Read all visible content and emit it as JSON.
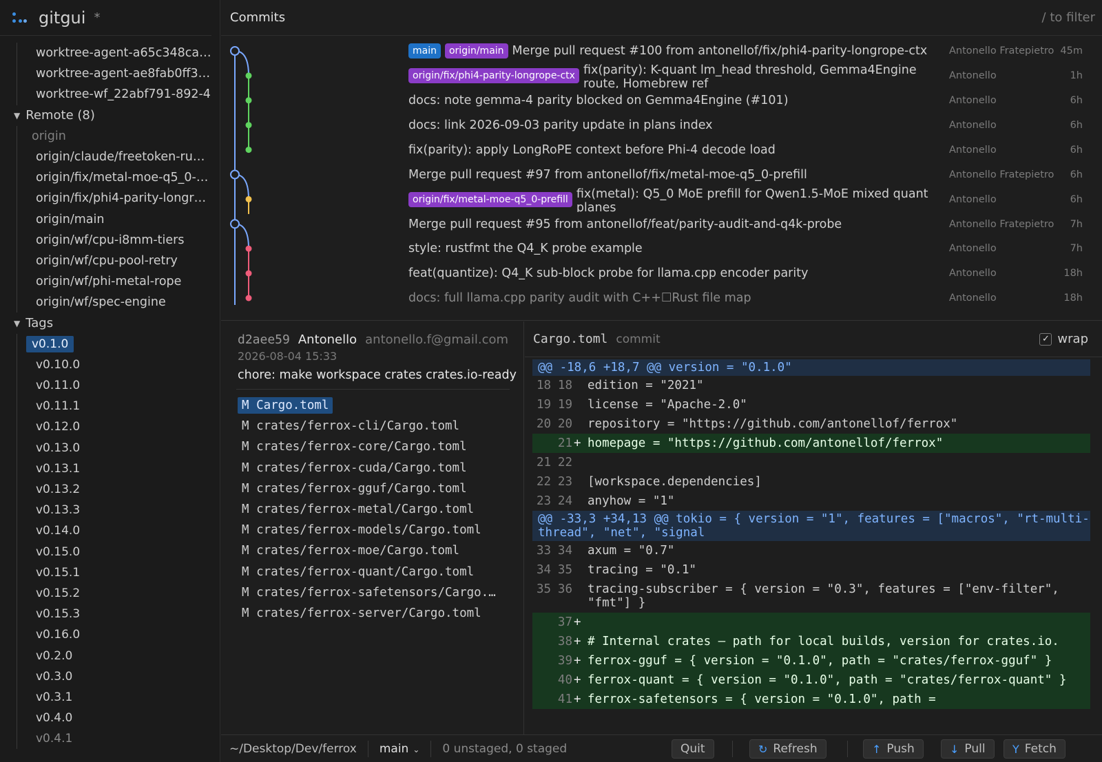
{
  "app": {
    "title": "gitgui",
    "dirty_marker": "*"
  },
  "sidebar": {
    "worktrees": [
      "worktree-agent-a65c348ca…",
      "worktree-agent-ae8fab0ff3…",
      "worktree-wf_22abf791-892-4"
    ],
    "remote_group": "Remote (8)",
    "remote_name": "origin",
    "remote_branches": [
      "origin/claude/freetoken-ru…",
      "origin/fix/metal-moe-q5_0-…",
      "origin/fix/phi4-parity-longr…",
      "origin/main",
      "origin/wf/cpu-i8mm-tiers",
      "origin/wf/cpu-pool-retry",
      "origin/wf/phi-metal-rope",
      "origin/wf/spec-engine"
    ],
    "tags_group": "Tags",
    "tags": [
      "v0.1.0",
      "v0.10.0",
      "v0.11.0",
      "v0.11.1",
      "v0.12.0",
      "v0.13.0",
      "v0.13.1",
      "v0.13.2",
      "v0.13.3",
      "v0.14.0",
      "v0.15.0",
      "v0.15.1",
      "v0.15.2",
      "v0.15.3",
      "v0.16.0",
      "v0.2.0",
      "v0.3.0",
      "v0.3.1",
      "v0.4.0",
      "v0.4.1"
    ],
    "selected_tag": "v0.1.0"
  },
  "commits": {
    "title": "Commits",
    "filter_hint": "/ to filter",
    "rows": [
      {
        "badges": [
          {
            "label": "main",
            "kind": "branch"
          },
          {
            "label": "origin/main",
            "kind": "remote"
          }
        ],
        "message": "Merge pull request #100 from antonellof/fix/phi4-parity-longrope-ctx",
        "author": "Antonello Fratepietro",
        "time": "45m",
        "wrap": false
      },
      {
        "badges": [
          {
            "label": "origin/fix/phi4-parity-longrope-ctx",
            "kind": "remote"
          }
        ],
        "message": "fix(parity): K-quant lm_head threshold, Gemma4Engine route, Homebrew ref",
        "author": "Antonello",
        "time": "1h",
        "wrap": true
      },
      {
        "badges": [],
        "message": "docs: note gemma-4 parity blocked on Gemma4Engine (#101)",
        "author": "Antonello",
        "time": "6h",
        "wrap": false
      },
      {
        "badges": [],
        "message": "docs: link 2026-09-03 parity update in plans index",
        "author": "Antonello",
        "time": "6h",
        "wrap": false
      },
      {
        "badges": [],
        "message": "fix(parity): apply LongRoPE context before Phi-4 decode load",
        "author": "Antonello",
        "time": "6h",
        "wrap": false
      },
      {
        "badges": [],
        "message": "Merge pull request #97 from antonellof/fix/metal-moe-q5_0-prefill",
        "author": "Antonello Fratepietro",
        "time": "6h",
        "wrap": false
      },
      {
        "badges": [
          {
            "label": "origin/fix/metal-moe-q5_0-prefill",
            "kind": "remote"
          }
        ],
        "message": "fix(metal): Q5_0 MoE prefill for Qwen1.5-MoE mixed quant planes",
        "author": "Antonello",
        "time": "6h",
        "wrap": true
      },
      {
        "badges": [],
        "message": "Merge pull request #95 from antonellof/feat/parity-audit-and-q4k-probe",
        "author": "Antonello Fratepietro",
        "time": "7h",
        "wrap": false
      },
      {
        "badges": [],
        "message": "style: rustfmt the Q4_K probe example",
        "author": "Antonello",
        "time": "7h",
        "wrap": false
      },
      {
        "badges": [],
        "message": "feat(quantize): Q4_K sub-block probe for llama.cpp encoder parity",
        "author": "Antonello",
        "time": "18h",
        "wrap": false
      },
      {
        "badges": [],
        "message": "docs: full llama.cpp parity audit with C++☐Rust file map",
        "author": "Antonello",
        "time": "18h",
        "wrap": false
      }
    ]
  },
  "details": {
    "sha": "d2aee59",
    "author": "Antonello",
    "email": "antonello.f@gmail.com",
    "date": "2026-08-04 15:33",
    "subject": "chore: make workspace crates crates.io-ready",
    "files": [
      "M Cargo.toml",
      "M crates/ferrox-cli/Cargo.toml",
      "M crates/ferrox-core/Cargo.toml",
      "M crates/ferrox-cuda/Cargo.toml",
      "M crates/ferrox-gguf/Cargo.toml",
      "M crates/ferrox-metal/Cargo.toml",
      "M crates/ferrox-models/Cargo.toml",
      "M crates/ferrox-moe/Cargo.toml",
      "M crates/ferrox-quant/Cargo.toml",
      "M crates/ferrox-safetensors/Cargo.…",
      "M crates/ferrox-server/Cargo.toml"
    ],
    "selected_file": "M Cargo.toml"
  },
  "diff": {
    "file": "Cargo.toml",
    "kind": "commit",
    "wrap_label": "wrap",
    "wrap_checked": "✓",
    "lines": [
      {
        "type": "hunk",
        "old": "",
        "new": "",
        "mark": "",
        "text": "@@ -18,6 +18,7 @@ version = \"0.1.0\""
      },
      {
        "type": "ctx",
        "old": "18",
        "new": "18",
        "mark": "",
        "text": "edition = \"2021\""
      },
      {
        "type": "ctx",
        "old": "19",
        "new": "19",
        "mark": "",
        "text": "license = \"Apache-2.0\""
      },
      {
        "type": "ctx",
        "old": "20",
        "new": "20",
        "mark": "",
        "text": "repository = \"https://github.com/antonellof/ferrox\""
      },
      {
        "type": "add",
        "old": "",
        "new": "21",
        "mark": "+",
        "text": "homepage = \"https://github.com/antonellof/ferrox\""
      },
      {
        "type": "ctx",
        "old": "21",
        "new": "22",
        "mark": "",
        "text": ""
      },
      {
        "type": "ctx",
        "old": "22",
        "new": "23",
        "mark": "",
        "text": "[workspace.dependencies]"
      },
      {
        "type": "ctx",
        "old": "23",
        "new": "24",
        "mark": "",
        "text": "anyhow = \"1\""
      },
      {
        "type": "hunk",
        "old": "",
        "new": "",
        "mark": "",
        "text": "@@ -33,3 +34,13 @@ tokio = { version = \"1\", features = [\"macros\", \"rt-multi-thread\", \"net\", \"signal"
      },
      {
        "type": "ctx",
        "old": "33",
        "new": "34",
        "mark": "",
        "text": "axum = \"0.7\""
      },
      {
        "type": "ctx",
        "old": "34",
        "new": "35",
        "mark": "",
        "text": "tracing = \"0.1\""
      },
      {
        "type": "ctx",
        "old": "35",
        "new": "36",
        "mark": "",
        "text": "tracing-subscriber = { version = \"0.3\", features = [\"env-filter\", \"fmt\"] }"
      },
      {
        "type": "add",
        "old": "",
        "new": "37",
        "mark": "+",
        "text": ""
      },
      {
        "type": "add",
        "old": "",
        "new": "38",
        "mark": "+",
        "text": "# Internal crates — path for local builds, version for crates.io."
      },
      {
        "type": "add",
        "old": "",
        "new": "39",
        "mark": "+",
        "text": "ferrox-gguf = { version = \"0.1.0\", path = \"crates/ferrox-gguf\" }"
      },
      {
        "type": "add",
        "old": "",
        "new": "40",
        "mark": "+",
        "text": "ferrox-quant = { version = \"0.1.0\", path = \"crates/ferrox-quant\" }"
      },
      {
        "type": "add",
        "old": "",
        "new": "41",
        "mark": "+",
        "text": "ferrox-safetensors = { version = \"0.1.0\", path ="
      }
    ]
  },
  "statusbar": {
    "path": "~/Desktop/Dev/ferrox",
    "branch": "main",
    "counts": "0 unstaged, 0 staged",
    "buttons": {
      "quit": "Quit",
      "refresh": "Refresh",
      "push": "Push",
      "pull": "Pull",
      "fetch": "Fetch"
    }
  },
  "colors": {
    "accent": "#1f72c7",
    "remote_badge": "#8a3cc7",
    "graph_blue": "#7aa8ff",
    "graph_green": "#5fd35f",
    "graph_yellow": "#f2c14e",
    "graph_pink": "#ef5c7a"
  }
}
